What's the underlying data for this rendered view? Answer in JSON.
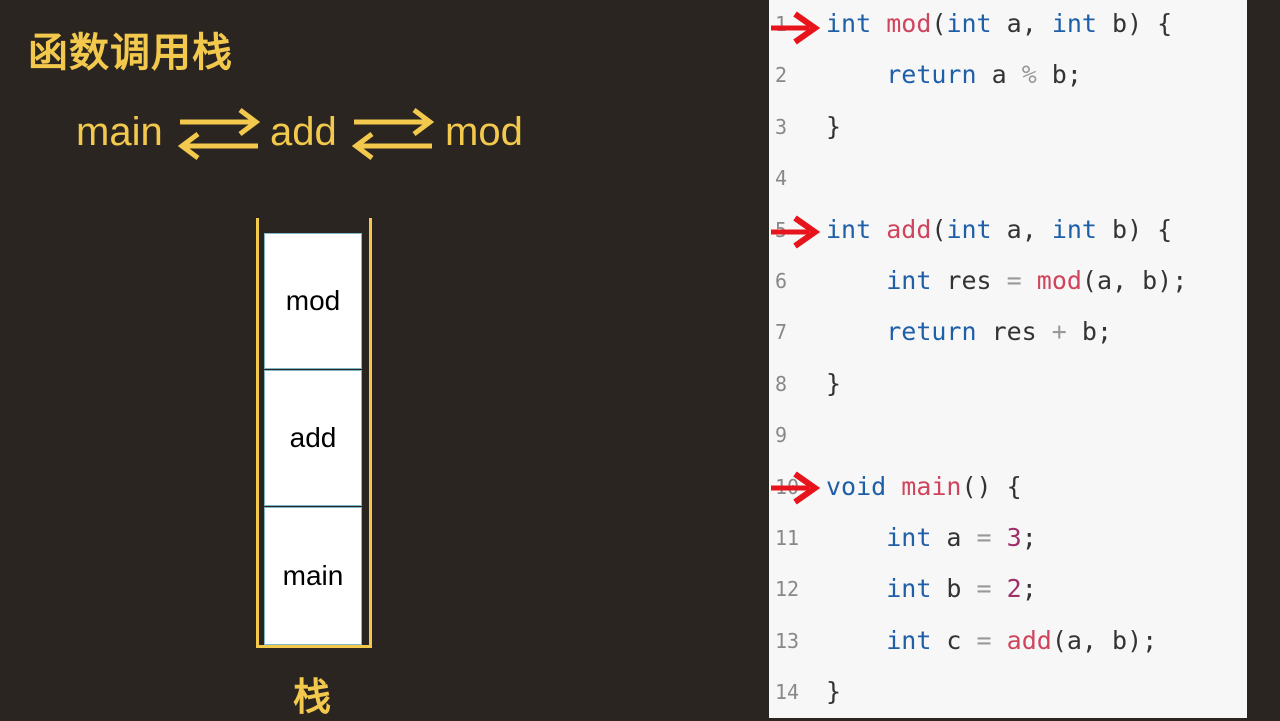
{
  "title": "函数调用栈",
  "flow": {
    "first": "main",
    "second": "add",
    "third": "mod"
  },
  "stack": {
    "frames": [
      "mod",
      "add",
      "main"
    ],
    "label": "栈"
  },
  "code_lines": [
    {
      "n": "1",
      "tokens": [
        [
          "kw",
          "int"
        ],
        [
          "t",
          " "
        ],
        [
          "fn",
          "mod"
        ],
        [
          "t",
          "("
        ],
        [
          "kw",
          "int"
        ],
        [
          "t",
          " a, "
        ],
        [
          "kw",
          "int"
        ],
        [
          "t",
          " b) {"
        ]
      ]
    },
    {
      "n": "2",
      "tokens": [
        [
          "t",
          "    "
        ],
        [
          "kw",
          "return"
        ],
        [
          "t",
          " a "
        ],
        [
          "op",
          "%"
        ],
        [
          "t",
          " b;"
        ]
      ]
    },
    {
      "n": "3",
      "tokens": [
        [
          "t",
          "}"
        ]
      ]
    },
    {
      "n": "4",
      "tokens": []
    },
    {
      "n": "5",
      "tokens": [
        [
          "kw",
          "int"
        ],
        [
          "t",
          " "
        ],
        [
          "fn",
          "add"
        ],
        [
          "t",
          "("
        ],
        [
          "kw",
          "int"
        ],
        [
          "t",
          " a, "
        ],
        [
          "kw",
          "int"
        ],
        [
          "t",
          " b) {"
        ]
      ]
    },
    {
      "n": "6",
      "tokens": [
        [
          "t",
          "    "
        ],
        [
          "kw",
          "int"
        ],
        [
          "t",
          " res "
        ],
        [
          "op",
          "="
        ],
        [
          "t",
          " "
        ],
        [
          "fn",
          "mod"
        ],
        [
          "t",
          "(a, b);"
        ]
      ]
    },
    {
      "n": "7",
      "tokens": [
        [
          "t",
          "    "
        ],
        [
          "kw",
          "return"
        ],
        [
          "t",
          " res "
        ],
        [
          "op",
          "+"
        ],
        [
          "t",
          " b;"
        ]
      ]
    },
    {
      "n": "8",
      "tokens": [
        [
          "t",
          "}"
        ]
      ]
    },
    {
      "n": "9",
      "tokens": []
    },
    {
      "n": "10",
      "tokens": [
        [
          "kw",
          "void"
        ],
        [
          "t",
          " "
        ],
        [
          "fn",
          "main"
        ],
        [
          "t",
          "() {"
        ]
      ]
    },
    {
      "n": "11",
      "tokens": [
        [
          "t",
          "    "
        ],
        [
          "kw",
          "int"
        ],
        [
          "t",
          " a "
        ],
        [
          "op",
          "="
        ],
        [
          "t",
          " "
        ],
        [
          "num",
          "3"
        ],
        [
          "t",
          ";"
        ]
      ]
    },
    {
      "n": "12",
      "tokens": [
        [
          "t",
          "    "
        ],
        [
          "kw",
          "int"
        ],
        [
          "t",
          " b "
        ],
        [
          "op",
          "="
        ],
        [
          "t",
          " "
        ],
        [
          "num",
          "2"
        ],
        [
          "t",
          ";"
        ]
      ]
    },
    {
      "n": "13",
      "tokens": [
        [
          "t",
          "    "
        ],
        [
          "kw",
          "int"
        ],
        [
          "t",
          " c "
        ],
        [
          "op",
          "="
        ],
        [
          "t",
          " "
        ],
        [
          "fn",
          "add"
        ],
        [
          "t",
          "(a, b);"
        ]
      ]
    },
    {
      "n": "14",
      "tokens": [
        [
          "t",
          "}"
        ]
      ]
    }
  ],
  "arrow_color": "#e8141b",
  "accent_color": "#f2c94c"
}
